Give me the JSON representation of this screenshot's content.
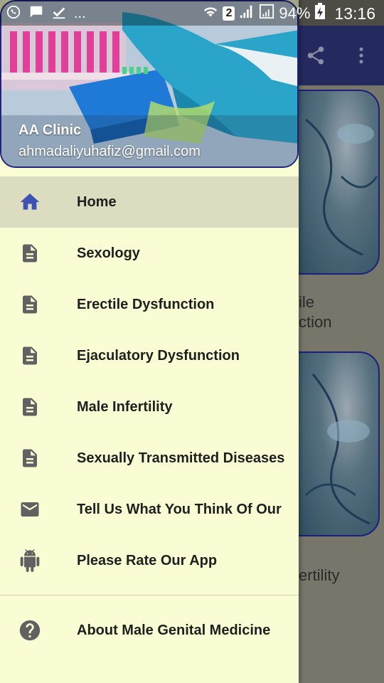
{
  "status_bar": {
    "left_icons": [
      "whatsapp-icon",
      "message-icon",
      "check-icon"
    ],
    "overflow": "...",
    "sim_badge": "2",
    "battery": "94%",
    "time": "13:16"
  },
  "app": {
    "toolbar": {
      "share_icon": "share-icon",
      "more_icon": "more-vert-icon"
    },
    "background_labels": [
      "ile\nction",
      "ertility"
    ]
  },
  "drawer": {
    "header": {
      "name": "AA Clinic",
      "email": "ahmadaliyuhafiz@gmail.com"
    },
    "items": [
      {
        "label": "Home",
        "icon": "home-icon",
        "active": true
      },
      {
        "label": "Sexology",
        "icon": "document-icon"
      },
      {
        "label": "Erectile Dysfunction",
        "icon": "document-icon"
      },
      {
        "label": "Ejaculatory Dysfunction",
        "icon": "document-icon"
      },
      {
        "label": "Male Infertility",
        "icon": "document-icon"
      },
      {
        "label": "Sexually Transmitted Diseases",
        "icon": "document-icon"
      },
      {
        "label": "Tell Us What You Think Of Our",
        "icon": "email-icon"
      },
      {
        "label": "Please Rate Our App",
        "icon": "android-icon"
      }
    ],
    "footer_item": {
      "label": "About Male Genital Medicine",
      "icon": "help-icon"
    }
  },
  "colors": {
    "drawer_bg": "#fafdd3",
    "active_item_bg": "#dcdcc0",
    "home_icon": "#3f51b5",
    "toolbar": "#242a5e"
  }
}
